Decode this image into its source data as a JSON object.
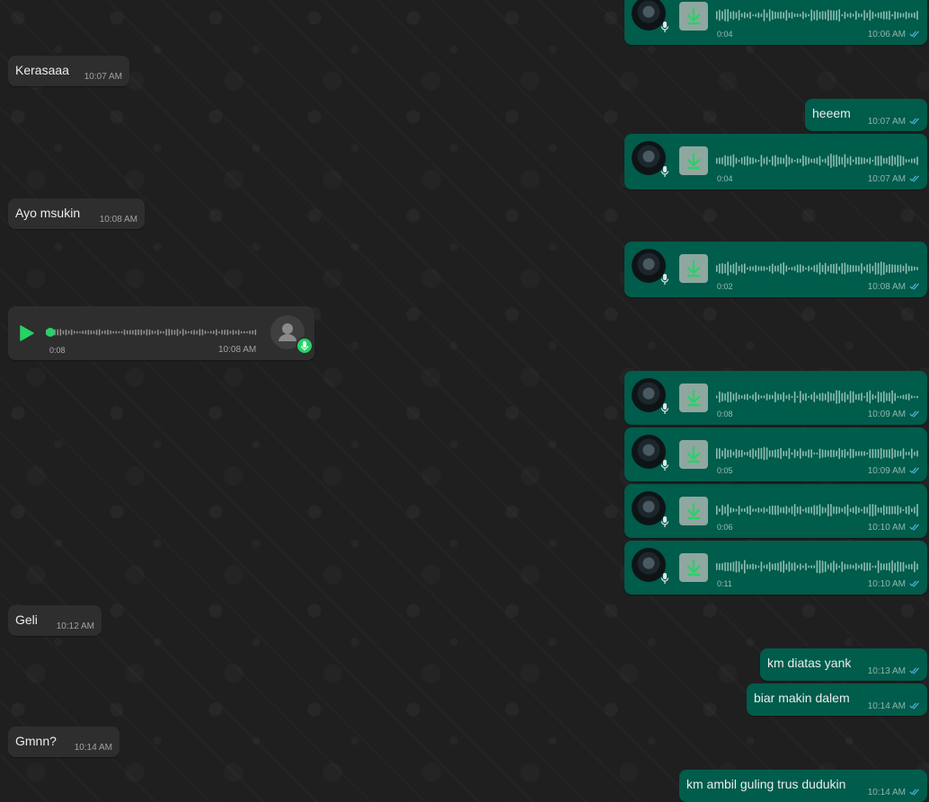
{
  "colors": {
    "incoming_bubble": "#2e2e2e",
    "outgoing_bubble": "#005c4b",
    "read_tick": "#53bdeb",
    "accent_green": "#25d366"
  },
  "messages": {
    "v1": {
      "duration": "0:04",
      "time": "10:06 AM"
    },
    "t1": {
      "text": "Kerasaaa",
      "time": "10:07 AM"
    },
    "t2": {
      "text": "heeem",
      "time": "10:07 AM"
    },
    "v2": {
      "duration": "0:04",
      "time": "10:07 AM"
    },
    "t3": {
      "text": "Ayo msukin",
      "time": "10:08 AM"
    },
    "v3": {
      "duration": "0:02",
      "time": "10:08 AM"
    },
    "vin": {
      "duration": "0:08",
      "time": "10:08 AM"
    },
    "v4": {
      "duration": "0:08",
      "time": "10:09 AM"
    },
    "v5": {
      "duration": "0:05",
      "time": "10:09 AM"
    },
    "v6": {
      "duration": "0:06",
      "time": "10:10 AM"
    },
    "v7": {
      "duration": "0:11",
      "time": "10:10 AM"
    },
    "t4": {
      "text": "Geli",
      "time": "10:12 AM"
    },
    "t5": {
      "text": "km diatas yank",
      "time": "10:13 AM"
    },
    "t6": {
      "text": "biar makin dalem",
      "time": "10:14 AM"
    },
    "t7": {
      "text": "Gmnn?",
      "time": "10:14 AM"
    },
    "t8": {
      "text": "km ambil guling trus dudukin",
      "time": "10:14 AM"
    }
  },
  "icons": {
    "play": "play-icon",
    "download": "download-icon",
    "mic": "microphone-icon",
    "ticks": "double-check-icon",
    "avatar": "avatar-icon"
  }
}
